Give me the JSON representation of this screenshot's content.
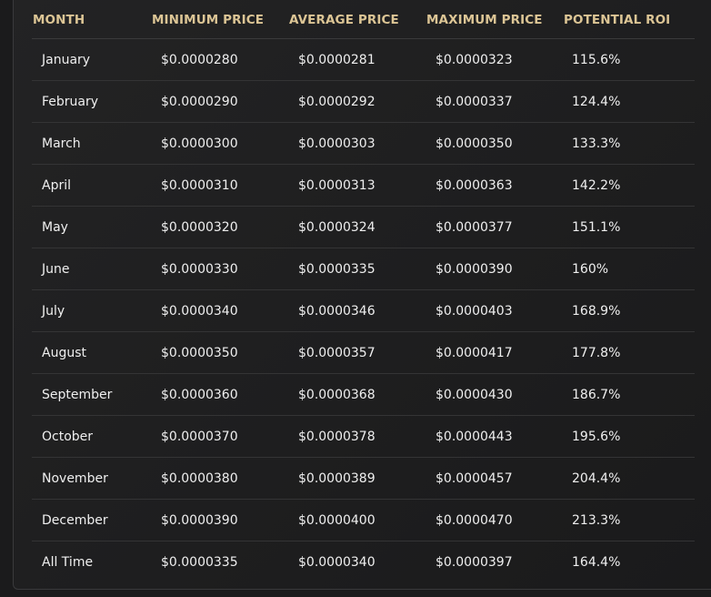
{
  "table": {
    "headers": {
      "month": "MONTH",
      "min": "MINIMUM PRICE",
      "avg": "AVERAGE PRICE",
      "max": "MAXIMUM PRICE",
      "roi": "POTENTIAL ROI"
    },
    "rows": [
      {
        "month": "January",
        "min": "$0.0000280",
        "avg": "$0.0000281",
        "max": "$0.0000323",
        "roi": "115.6%"
      },
      {
        "month": "February",
        "min": "$0.0000290",
        "avg": "$0.0000292",
        "max": "$0.0000337",
        "roi": "124.4%"
      },
      {
        "month": "March",
        "min": "$0.0000300",
        "avg": "$0.0000303",
        "max": "$0.0000350",
        "roi": "133.3%"
      },
      {
        "month": "April",
        "min": "$0.0000310",
        "avg": "$0.0000313",
        "max": "$0.0000363",
        "roi": "142.2%"
      },
      {
        "month": "May",
        "min": "$0.0000320",
        "avg": "$0.0000324",
        "max": "$0.0000377",
        "roi": "151.1%"
      },
      {
        "month": "June",
        "min": "$0.0000330",
        "avg": "$0.0000335",
        "max": "$0.0000390",
        "roi": "160%"
      },
      {
        "month": "July",
        "min": "$0.0000340",
        "avg": "$0.0000346",
        "max": "$0.0000403",
        "roi": "168.9%"
      },
      {
        "month": "August",
        "min": "$0.0000350",
        "avg": "$0.0000357",
        "max": "$0.0000417",
        "roi": "177.8%"
      },
      {
        "month": "September",
        "min": "$0.0000360",
        "avg": "$0.0000368",
        "max": "$0.0000430",
        "roi": "186.7%"
      },
      {
        "month": "October",
        "min": "$0.0000370",
        "avg": "$0.0000378",
        "max": "$0.0000443",
        "roi": "195.6%"
      },
      {
        "month": "November",
        "min": "$0.0000380",
        "avg": "$0.0000389",
        "max": "$0.0000457",
        "roi": "204.4%"
      },
      {
        "month": "December",
        "min": "$0.0000390",
        "avg": "$0.0000400",
        "max": "$0.0000470",
        "roi": "213.3%"
      },
      {
        "month": "All Time",
        "min": "$0.0000335",
        "avg": "$0.0000340",
        "max": "$0.0000397",
        "roi": "164.4%"
      }
    ]
  },
  "colors": {
    "header_text": "#dcc595",
    "body_text": "#efefef",
    "background": "#1e1e1f",
    "row_divider": "#343435"
  }
}
